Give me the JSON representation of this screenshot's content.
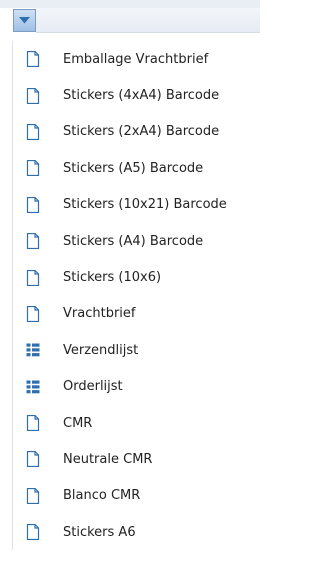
{
  "dropdown": {
    "icon": "chevron-down-icon"
  },
  "colors": {
    "icon_blue": "#2f6fb0",
    "accent": "#9fbfe6"
  },
  "menu": {
    "items": [
      {
        "label": "Emballage Vrachtbrief",
        "icon": "document-icon"
      },
      {
        "label": "Stickers (4xA4) Barcode",
        "icon": "document-icon"
      },
      {
        "label": "Stickers (2xA4) Barcode",
        "icon": "document-icon"
      },
      {
        "label": "Stickers (A5) Barcode",
        "icon": "document-icon"
      },
      {
        "label": "Stickers (10x21) Barcode",
        "icon": "document-icon"
      },
      {
        "label": "Stickers (A4) Barcode",
        "icon": "document-icon"
      },
      {
        "label": "Stickers (10x6)",
        "icon": "document-icon"
      },
      {
        "label": "Vrachtbrief",
        "icon": "document-icon"
      },
      {
        "label": "Verzendlijst",
        "icon": "list-icon"
      },
      {
        "label": "Orderlijst",
        "icon": "list-icon"
      },
      {
        "label": "CMR",
        "icon": "document-icon"
      },
      {
        "label": "Neutrale CMR",
        "icon": "document-icon"
      },
      {
        "label": "Blanco CMR",
        "icon": "document-icon"
      },
      {
        "label": "Stickers A6",
        "icon": "document-icon"
      }
    ]
  }
}
